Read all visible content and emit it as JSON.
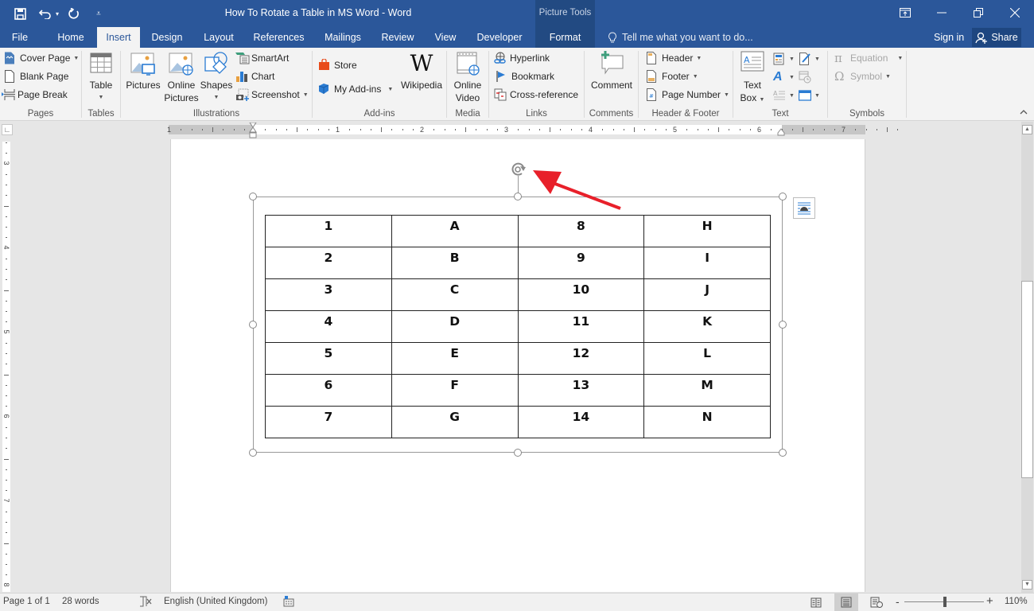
{
  "window": {
    "title": "How To Rotate a Table in MS Word - Word",
    "contextual_group": "Picture Tools",
    "controls": [
      "ribbon-display-options",
      "minimize",
      "restore",
      "close"
    ]
  },
  "quick_access": {
    "save": "save-icon",
    "undo": "undo-icon",
    "redo": "redo-icon",
    "customize": "customize-qat-icon"
  },
  "tabs": [
    {
      "label": "File"
    },
    {
      "label": "Home"
    },
    {
      "label": "Insert",
      "active": true
    },
    {
      "label": "Design"
    },
    {
      "label": "Layout"
    },
    {
      "label": "References"
    },
    {
      "label": "Mailings"
    },
    {
      "label": "Review"
    },
    {
      "label": "View"
    },
    {
      "label": "Developer"
    },
    {
      "label": "Format",
      "contextual": true
    }
  ],
  "tell_me": "Tell me what you want to do...",
  "sign_in": "Sign in",
  "share": "Share",
  "ribbon": {
    "pages": {
      "label": "Pages",
      "cover_page": "Cover Page",
      "blank_page": "Blank Page",
      "page_break": "Page Break"
    },
    "tables": {
      "label": "Tables",
      "table": "Table"
    },
    "illustrations": {
      "label": "Illustrations",
      "pictures": "Pictures",
      "online_pictures_1": "Online",
      "online_pictures_2": "Pictures",
      "shapes": "Shapes",
      "smartart": "SmartArt",
      "chart": "Chart",
      "screenshot": "Screenshot"
    },
    "addins": {
      "label": "Add-ins",
      "store": "Store",
      "my_addins": "My Add-ins",
      "wikipedia": "Wikipedia"
    },
    "media": {
      "label": "Media",
      "online_video_1": "Online",
      "online_video_2": "Video"
    },
    "links": {
      "label": "Links",
      "hyperlink": "Hyperlink",
      "bookmark": "Bookmark",
      "cross_reference": "Cross-reference"
    },
    "comments": {
      "label": "Comments",
      "comment": "Comment"
    },
    "header_footer": {
      "label": "Header & Footer",
      "header": "Header",
      "footer": "Footer",
      "page_number": "Page Number"
    },
    "text": {
      "label": "Text",
      "text_box_1": "Text",
      "text_box_2": "Box"
    },
    "symbols": {
      "label": "Symbols",
      "equation": "Equation",
      "symbol": "Symbol"
    }
  },
  "ruler": {
    "horizontal_labels": [
      "1",
      "1",
      "2",
      "3",
      "4",
      "5",
      "6",
      "7"
    ],
    "vertical_labels": [
      "3",
      "4",
      "5",
      "6",
      "7",
      "8"
    ]
  },
  "table": {
    "rows": [
      [
        "1",
        "A",
        "8",
        "H"
      ],
      [
        "2",
        "B",
        "9",
        "I"
      ],
      [
        "3",
        "C",
        "10",
        "J"
      ],
      [
        "4",
        "D",
        "11",
        "K"
      ],
      [
        "5",
        "E",
        "12",
        "L"
      ],
      [
        "6",
        "F",
        "13",
        "M"
      ],
      [
        "7",
        "G",
        "14",
        "N"
      ]
    ]
  },
  "annotation": {
    "arrow_color": "#e8202a",
    "points_to": "rotate-handle"
  },
  "status": {
    "page": "Page 1 of 1",
    "words": "28 words",
    "language": "English (United Kingdom)",
    "zoom": "110%",
    "zoom_minus": "-",
    "zoom_plus": "+"
  },
  "colors": {
    "brand": "#2b579a",
    "contextual_tab": "#224a82",
    "ribbon_bg": "#f3f3f3"
  }
}
